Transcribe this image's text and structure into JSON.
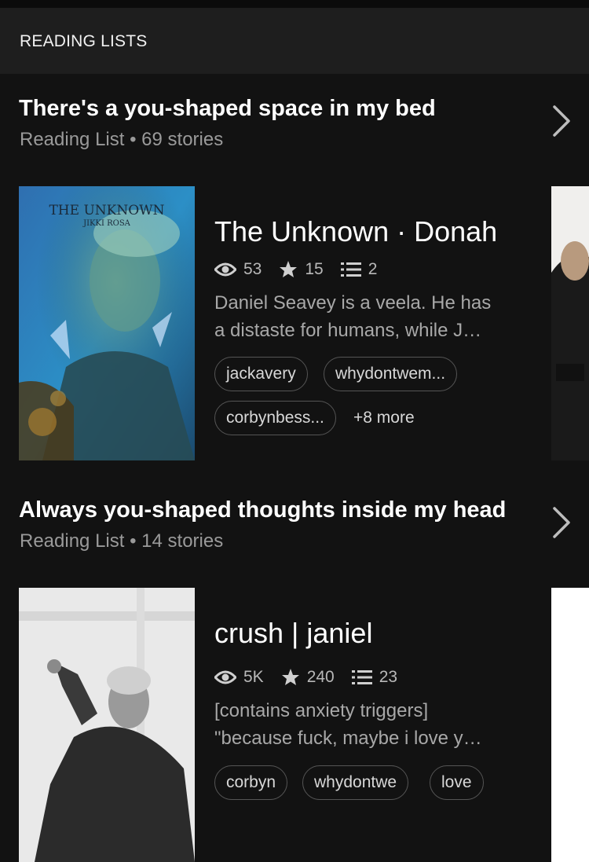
{
  "header": {
    "title": "READING LISTS"
  },
  "lists": [
    {
      "title": "There's a you-shaped space in my bed",
      "meta": "Reading List • 69 stories",
      "story": {
        "title": "The Unknown · Donah",
        "cover_title": "THE UNKNOWN",
        "cover_author": "JIKKI ROSA",
        "reads": "53",
        "votes": "15",
        "parts": "2",
        "description_line1": "Daniel Seavey is a veela. He has",
        "description_line2": "a distaste for humans, while J…",
        "tags": [
          "jackavery",
          "whydontwem...",
          "corbynbess..."
        ],
        "more_tags": "+8 more"
      }
    },
    {
      "title": "Always you-shaped thoughts inside my head",
      "meta": "Reading List • 14 stories",
      "story": {
        "title": "crush | janiel",
        "reads": "5K",
        "votes": "240",
        "parts": "23",
        "description_line1": "[contains anxiety triggers]",
        "description_line2": "\"because fuck, maybe i love y…",
        "tags": [
          "corbyn",
          "whydontwe",
          "love"
        ]
      }
    }
  ],
  "icons": {
    "reads": "eye-icon",
    "votes": "star-icon",
    "parts": "list-icon",
    "open": "chevron-right-icon"
  },
  "colors": {
    "background": "#121212",
    "header_bg": "#1e1e1e",
    "muted_text": "#9a9a9a",
    "tag_border": "#555555"
  }
}
